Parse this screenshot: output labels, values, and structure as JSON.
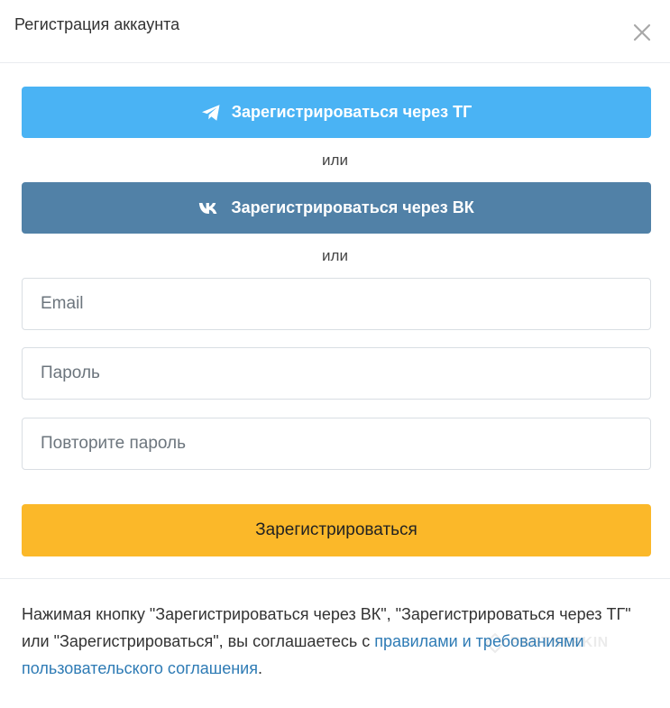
{
  "modal": {
    "title": "Регистрация аккаунта",
    "close_icon": "close-icon"
  },
  "social": {
    "telegram_label": "Зарегистрироваться через ТГ",
    "telegram_icon": "telegram-plane-icon",
    "telegram_color": "#4ab3f4",
    "or_1": "или",
    "vk_label": "Зарегистрироваться через ВК",
    "vk_icon": "vk-logo-icon",
    "vk_color": "#5181a7",
    "or_2": "или"
  },
  "form": {
    "email_placeholder": "Email",
    "password_placeholder": "Пароль",
    "repeat_password_placeholder": "Повторите пароль",
    "submit_label": "Зарегистрироваться",
    "submit_color": "#fbb829"
  },
  "footer": {
    "text_before_link": "Нажимая кнопку \"Зарегистрироваться через ВК\", \"Зарегистрироваться через ТГ\" или \"Зарегистрироваться\", вы соглашаетесь с ",
    "link_text": "правилами и требованиями пользовательского соглашения",
    "text_after_link": ".",
    "link_color": "#2e7bb5"
  },
  "watermark": {
    "text": "PARTNERKIN"
  }
}
